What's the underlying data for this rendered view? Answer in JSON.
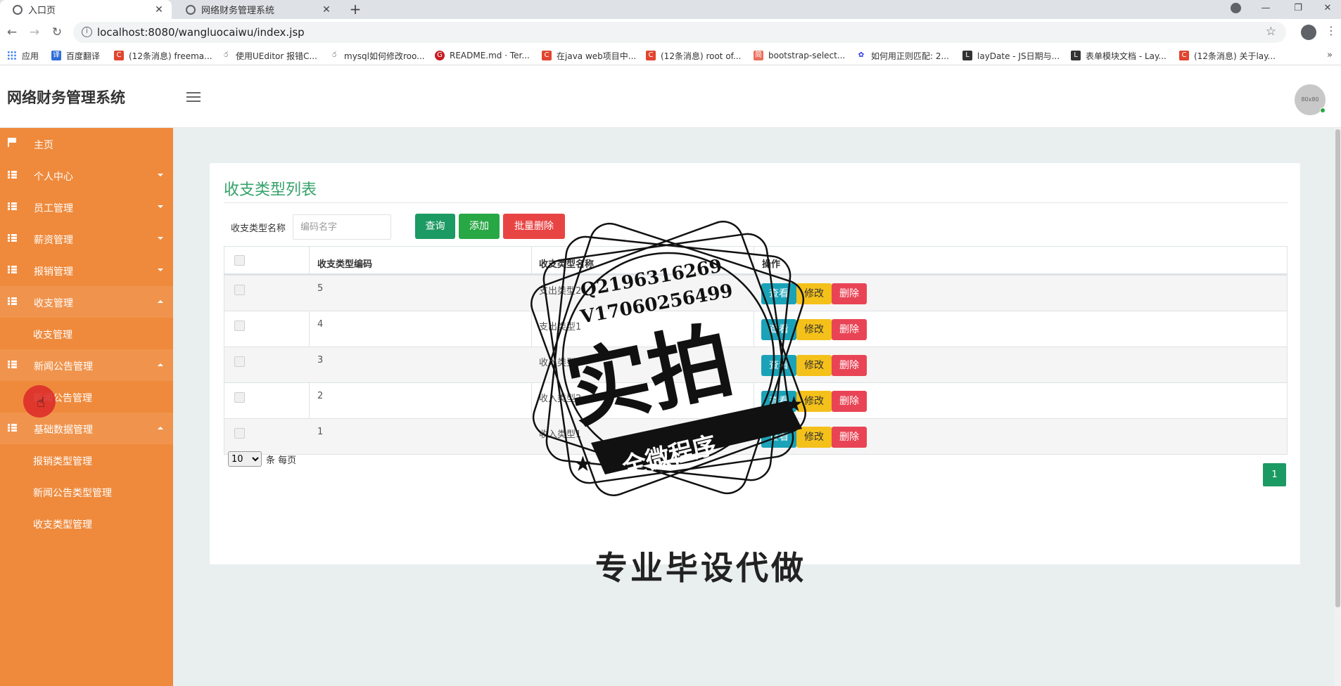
{
  "browser": {
    "tabs": [
      {
        "title": "入口页",
        "active": true
      },
      {
        "title": "网络财务管理系统",
        "active": false
      }
    ],
    "url": "localhost:8080/wangluocaiwu/index.jsp",
    "bookmarks": [
      {
        "label": "应用",
        "icon": "apps-icon",
        "color": "#4285f4"
      },
      {
        "label": "百度翻译",
        "icon": "translate-icon",
        "color": "#2f6bd8"
      },
      {
        "label": "(12条消息) freema...",
        "icon": "csdn-icon",
        "color": "#e1452f"
      },
      {
        "label": "使用UEditor 报错C...",
        "icon": "cnblogs-icon",
        "color": "#555555"
      },
      {
        "label": "mysql如何修改roo...",
        "icon": "cnblogs-icon",
        "color": "#555555"
      },
      {
        "label": "README.md · Ter...",
        "icon": "gitee-icon",
        "color": "#c71d23"
      },
      {
        "label": "在java web项目中...",
        "icon": "csdn-icon",
        "color": "#e1452f"
      },
      {
        "label": "(12条消息) root of...",
        "icon": "csdn-icon",
        "color": "#e1452f"
      },
      {
        "label": "bootstrap-select...",
        "icon": "jianshu-icon",
        "color": "#ea6f5a"
      },
      {
        "label": "如何用正则匹配: 2...",
        "icon": "baidu-icon",
        "color": "#2932e1"
      },
      {
        "label": "layDate - JS日期与...",
        "icon": "layui-icon",
        "color": "#333333"
      },
      {
        "label": "表单模块文档 - Lay...",
        "icon": "layui-icon",
        "color": "#333333"
      },
      {
        "label": "(12条消息) 关于lay...",
        "icon": "csdn-icon",
        "color": "#e1452f"
      }
    ]
  },
  "header": {
    "app_title": "网络财务管理系统",
    "avatar_text": "80x80"
  },
  "sidebar": {
    "items": [
      {
        "label": "主页",
        "icon": "flag-icon"
      },
      {
        "label": "个人中心",
        "icon": "grid-icon"
      },
      {
        "label": "员工管理",
        "icon": "grid-icon"
      },
      {
        "label": "薪资管理",
        "icon": "grid-icon"
      },
      {
        "label": "报销管理",
        "icon": "grid-icon"
      },
      {
        "label": "收支管理",
        "icon": "grid-icon"
      },
      {
        "label": "新闻公告管理",
        "icon": "grid-icon"
      },
      {
        "label": "基础数据管理",
        "icon": "grid-icon"
      }
    ],
    "subitems": {
      "income": "收支管理",
      "news": "新闻公告管理",
      "expense_type": "报销类型管理",
      "news_type": "新闻公告类型管理",
      "income_type": "收支类型管理"
    }
  },
  "main": {
    "panel_title": "收支类型列表",
    "filter": {
      "label": "收支类型名称",
      "placeholder": "编码名字"
    },
    "buttons": {
      "search": "查询",
      "add": "添加",
      "batch_delete": "批量删除"
    },
    "table": {
      "headers": [
        "收支类型编码",
        "收支类型名称",
        "操作"
      ],
      "rows": [
        {
          "code": "5",
          "name": "支出类型2"
        },
        {
          "code": "4",
          "name": "支出类型1"
        },
        {
          "code": "3",
          "name": "收入类型3"
        },
        {
          "code": "2",
          "name": "收入类型2"
        },
        {
          "code": "1",
          "name": "收入类型1"
        }
      ],
      "actions": {
        "view": "查看",
        "edit": "修改",
        "delete": "删除"
      }
    },
    "pagination": {
      "per_page": "10",
      "per_page_label": "条 每页",
      "current_page": "1"
    },
    "bottom_text": "专业毕设代做"
  },
  "watermark": {
    "line1": "Q2196316269",
    "line2": "V17060256499",
    "big": "实拍",
    "banner": "全微程序"
  },
  "colors": {
    "sidebar": "#ef8a3c",
    "accent_green": "#1c9a63",
    "title_green": "#35a26a",
    "danger": "#e94444",
    "info": "#1aa3b8",
    "warning": "#f4c01a"
  }
}
